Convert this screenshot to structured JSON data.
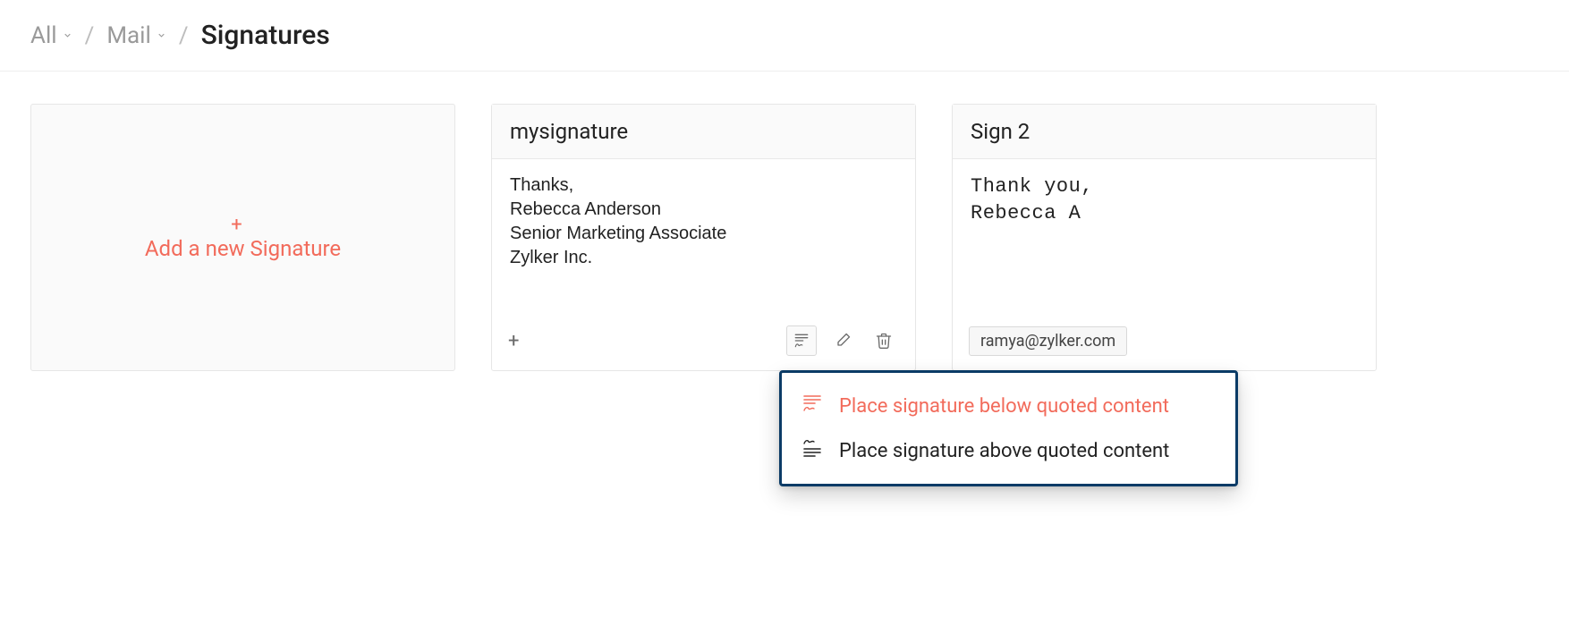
{
  "breadcrumb": {
    "items": [
      {
        "label": "All"
      },
      {
        "label": "Mail"
      }
    ],
    "current": "Signatures"
  },
  "add_card": {
    "label": "Add a new Signature"
  },
  "signatures": [
    {
      "title": "mysignature",
      "lines": [
        "Thanks,",
        "Rebecca Anderson",
        "Senior Marketing Associate",
        "Zylker Inc."
      ],
      "position_menu": {
        "below": "Place signature below quoted content",
        "above": "Place signature above quoted content"
      }
    },
    {
      "title": "Sign 2",
      "lines": [
        "Thank you,",
        "Rebecca A"
      ],
      "email_chip": "ramya@zylker.com"
    }
  ]
}
